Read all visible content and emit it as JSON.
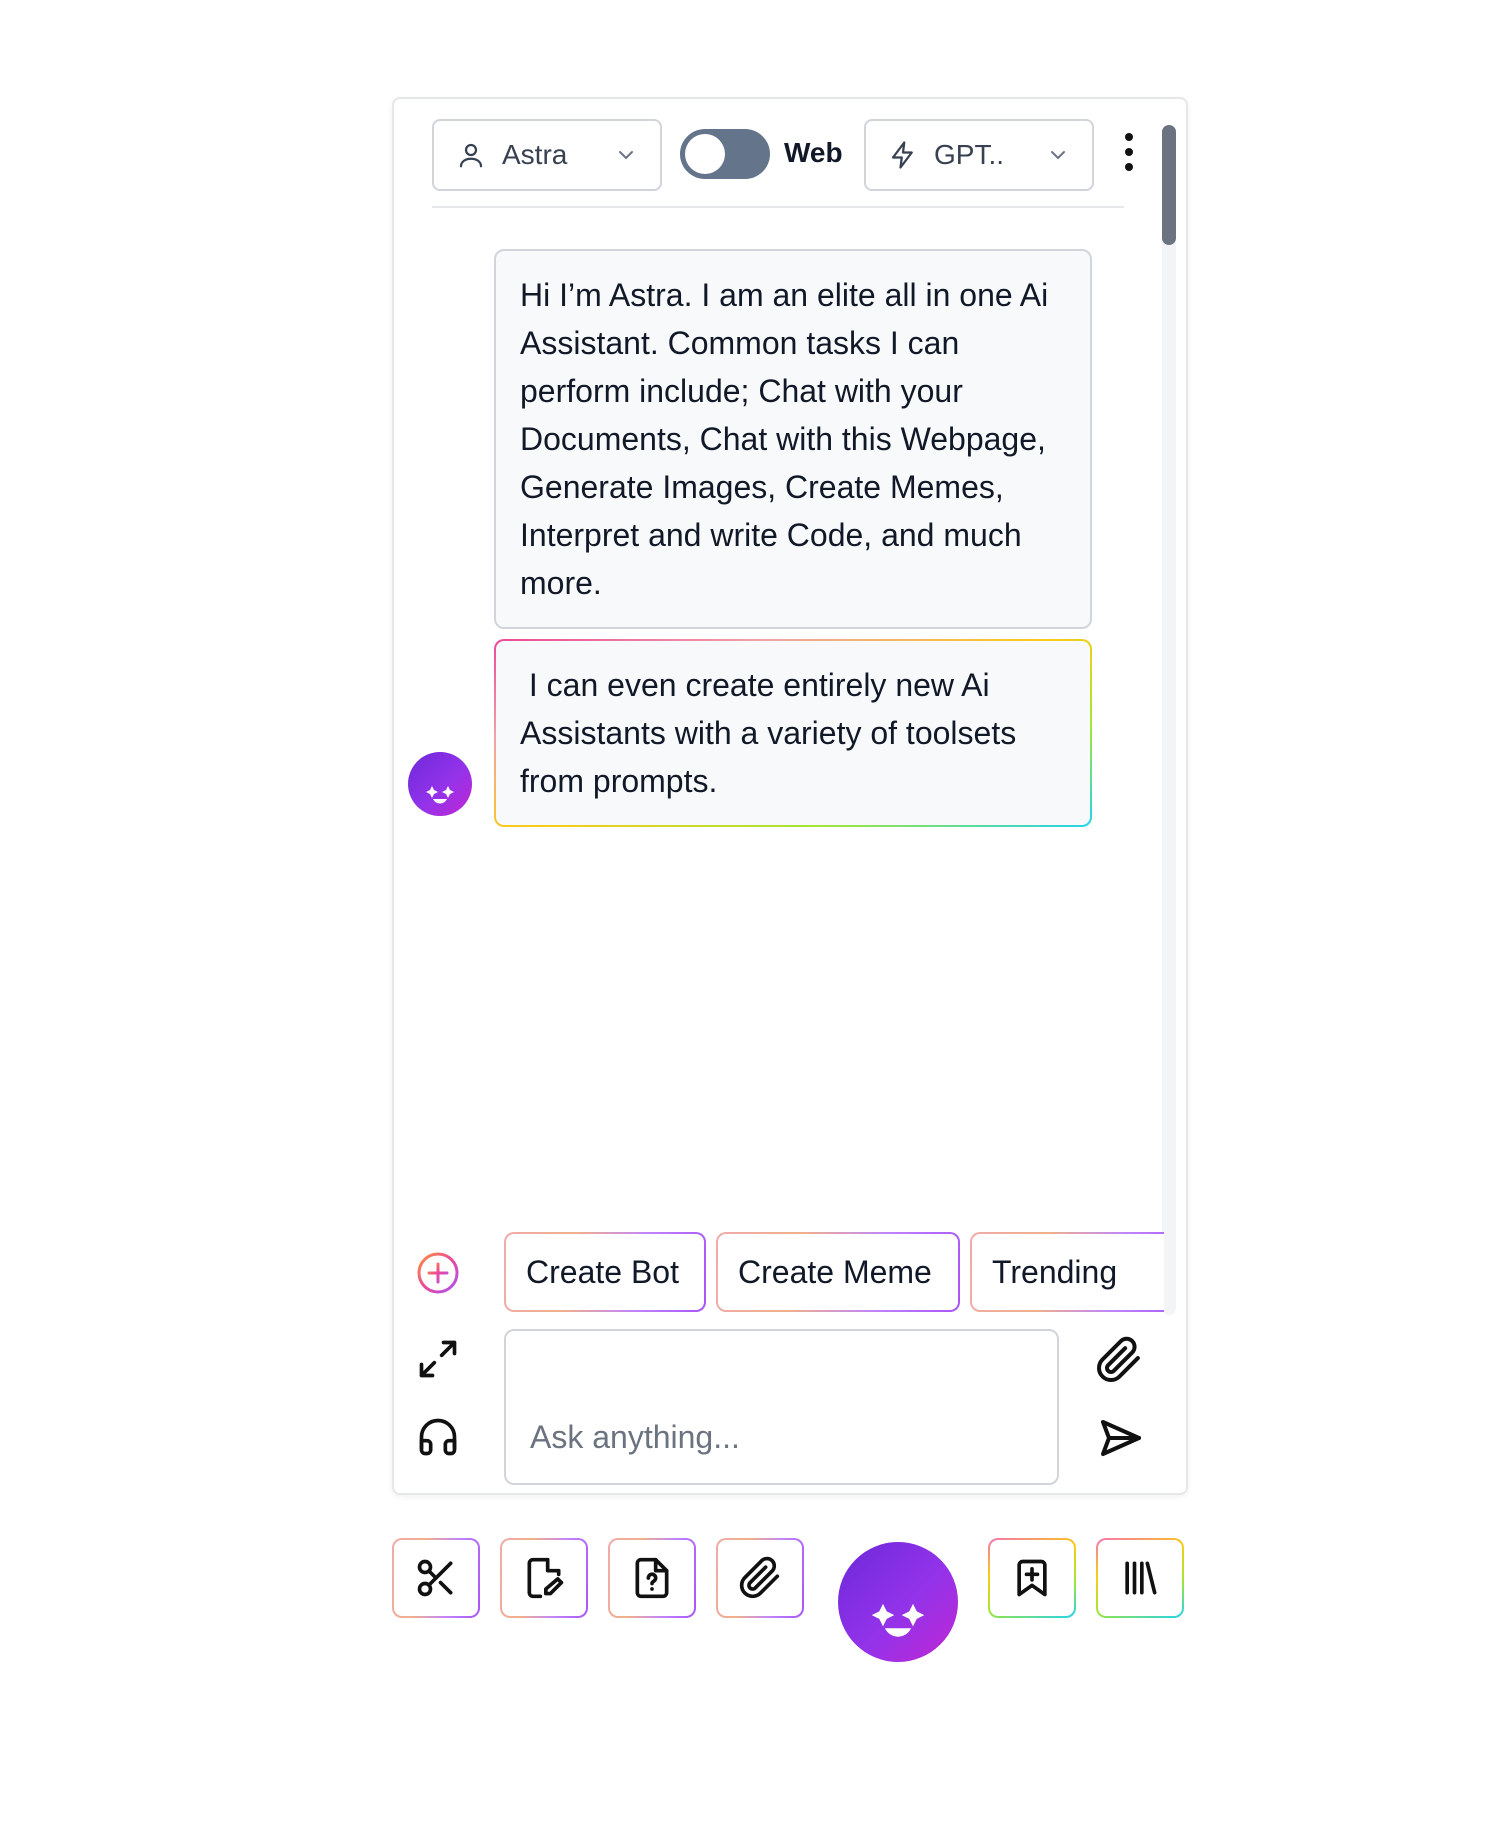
{
  "header": {
    "assistant_select": {
      "label": "Astra",
      "icon": "user-icon"
    },
    "web_toggle": {
      "label": "Web",
      "on": false
    },
    "model_select": {
      "label": "GPT..",
      "icon": "lightning-icon"
    },
    "menu_icon": "kebab-menu-icon"
  },
  "messages": [
    {
      "text": "Hi I’m Astra. I am an elite all in one Ai Assistant. Common tasks I can perform include; Chat with your Documents, Chat with this Webpage, Generate Images, Create Memes, Interpret and write Code, and much more."
    },
    {
      "text": " I can even create entirely new Ai Assistants with a variety of toolsets from prompts."
    }
  ],
  "quick_actions": [
    "Create Bot",
    "Create Meme",
    "Trending"
  ],
  "composer": {
    "placeholder": "Ask anything...",
    "left_icons": [
      "add-circle-icon",
      "expand-icon",
      "headphones-icon"
    ],
    "right_icons": [
      "paperclip-icon",
      "send-icon"
    ]
  },
  "toolbar": {
    "tools": [
      "scissors-icon",
      "edit-document-icon",
      "help-document-icon",
      "paperclip-icon",
      "assistant-avatar-icon",
      "bookmark-add-icon",
      "library-icon"
    ]
  },
  "colors": {
    "accent_purple": "#9333ea",
    "toggle_off": "#64748b",
    "bubble_bg": "#f8f9fb"
  }
}
